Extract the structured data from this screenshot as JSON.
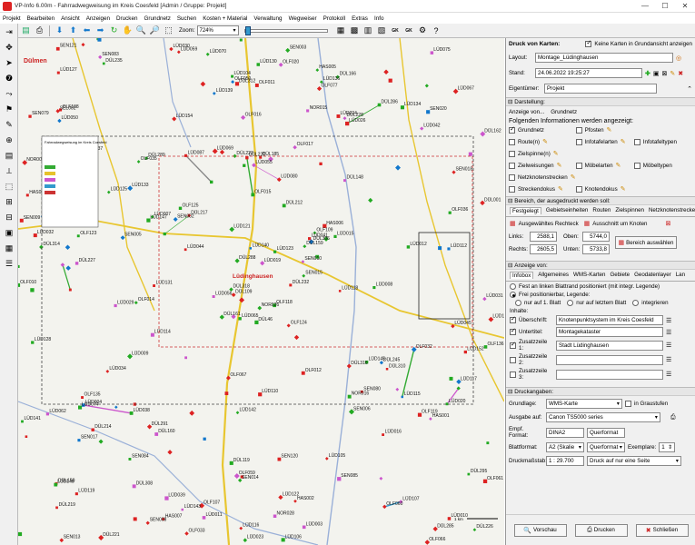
{
  "window": {
    "title": "VP-Info 6.00m - Fahrradwegweisung im Kreis Coesfeld [Admin / Gruppe: Projekt]",
    "minimize": "—",
    "maximize": "☐",
    "close": "✕"
  },
  "menu": [
    "Projekt",
    "Bearbeiten",
    "Ansicht",
    "Anzeigen",
    "Drucken",
    "Grundnetz",
    "Suchen",
    "Kosten + Material",
    "Verwaltung",
    "Wegweiser",
    "Protokoll",
    "Extras",
    "Info"
  ],
  "toolbar": {
    "zoom_label": "Zoom:",
    "zoom_value": "724%",
    "text_buttons": [
      "GK",
      "GK"
    ]
  },
  "map": {
    "town_label": "Dülmen",
    "town_label2": "Lüdinghausen",
    "scale_label": "1 km",
    "legend_title": "Fahrradwegweisung im Kreis Coesfeld",
    "labels": [
      "DÜL46",
      "DÜL147",
      "DÜL109",
      "DÜL150",
      "DÜL159",
      "DÜL160",
      "DÜL166",
      "DÜL185",
      "DÜL228",
      "DÜL232",
      "DÜL235",
      "DÜL226",
      "DÜL227",
      "DÜL162",
      "DÜL161",
      "DÜL148",
      "DÜL221",
      "DÜL223",
      "DÜL212",
      "DÜL214",
      "DÜL217",
      "DÜL219",
      "DÜL308",
      "DÜL220",
      "DÜL306",
      "DÜL310",
      "DÜL337",
      "DÜL312",
      "DÜL314",
      "DÜL316",
      "DÜL001",
      "DÜL318",
      "DÜL119",
      "DÜL288",
      "DÜL289",
      "DÜL286",
      "DÜL291",
      "DÜL285",
      "DÜL295",
      "DÜL245",
      "SEN003",
      "SEN002",
      "SEN005",
      "SEN006",
      "SEN008",
      "SEN009",
      "SEN010",
      "SEN013",
      "SEN014",
      "SEN015",
      "SEN017",
      "SEN018",
      "SEN079",
      "SEN080",
      "SEN085",
      "SEN084",
      "SEN083",
      "SEN121",
      "SEN120",
      "SEN020",
      "LÜD130",
      "LÜD131",
      "LÜD132",
      "LÜD133",
      "LÜD134",
      "LÜD135",
      "LÜD136",
      "LÜD139",
      "LÜD140",
      "LÜD141",
      "LÜD142",
      "LÜD143",
      "LÜD145",
      "LÜD147",
      "LÜD148",
      "LÜD127",
      "LÜD125",
      "LÜD128",
      "LÜD121",
      "LÜD122",
      "LÜD123",
      "LÜD119",
      "LÜD118",
      "LÜD117",
      "LÜD116",
      "LÜD112",
      "LÜD110",
      "LÜD107",
      "LÜD106",
      "LÜD105",
      "LÜD104",
      "LÜD155",
      "LÜD015",
      "LÜD016",
      "LÜD019",
      "LÜD020",
      "LÜD022",
      "LÜD023",
      "LÜD024",
      "LÜD026",
      "LÜD029",
      "LÜD030",
      "LÜD031",
      "LÜD032",
      "LÜD034",
      "LÜD038",
      "LÜD039",
      "LÜD041",
      "LÜD042",
      "LÜD044",
      "LÜD045",
      "LÜD050",
      "LÜD055",
      "LÜD056",
      "LÜD059",
      "LÜD062",
      "LÜD065",
      "LÜD067",
      "LÜD069",
      "LÜD070",
      "LÜD074",
      "LÜD075",
      "LÜD080",
      "LÜD087",
      "LÜD008",
      "LÜD009",
      "LÜD010",
      "LÜD011",
      "LÜD012",
      "LÜD013",
      "LÜD004",
      "LÜD003",
      "LÜD007",
      "LÜD154",
      "LÜD152",
      "LÜD115",
      "LÜD114",
      "OLF135",
      "OLF136",
      "OLF125",
      "OLF124",
      "OLF123",
      "OLF119",
      "OLF118",
      "OLF109",
      "OLF108",
      "OLF107",
      "OLF060",
      "OLF059",
      "OLF050",
      "OLF036",
      "OLF035",
      "OLF034",
      "OLF033",
      "OLF032",
      "OLF020",
      "OLF016",
      "OLF015",
      "OLF014",
      "OLF017",
      "OLF012",
      "OLF011",
      "OLF010",
      "OLF013",
      "OLF077",
      "OLF068",
      "OLF067",
      "OLF061",
      "OLF064",
      "OLF066",
      "HAS001",
      "HAS002",
      "HAS004",
      "HAS005",
      "HAS006",
      "HAS007",
      "NOR015",
      "NOR016",
      "NOR001",
      "NOR018",
      "NOR025",
      "NOR026",
      "NOR028",
      "SEL001",
      "SEL002"
    ]
  },
  "panel": {
    "druck_von_karten": "Druck von Karten:",
    "keine_karten": "Keine Karten in Grundansicht anzeigen",
    "layout_label": "Layout:",
    "layout_value": "Montage_Lüdinghausen",
    "stand_label": "Stand:",
    "stand_value": "24.06.2022 19:25:27",
    "eigentuemer_label": "Eigentümer:",
    "eigentuemer_value": "Projekt",
    "darstellung": "Darstellung:",
    "anzeige_von": "Anzeige von...",
    "anzeige_von_value": "Grundnetz",
    "folgende_info": "Folgenden Informationen werden angezeigt:",
    "info_items": [
      {
        "label": "Grundnetz",
        "checked": true
      },
      {
        "label": "Pfosten",
        "checked": false
      },
      {
        "label": "",
        "checked": false
      },
      {
        "label": "Route(n)",
        "checked": false
      },
      {
        "label": "Infotafelarten",
        "checked": false
      },
      {
        "label": "Infotafeltypen",
        "checked": false
      },
      {
        "label": "Zielspinne(n)",
        "checked": false
      },
      {
        "label": "",
        "checked": false
      },
      {
        "label": "",
        "checked": false
      },
      {
        "label": "Zielweisungen",
        "checked": false
      },
      {
        "label": "Möbelarten",
        "checked": false
      },
      {
        "label": "Möbeltypen",
        "checked": false
      },
      {
        "label": "Netzknotenstrecken",
        "checked": false
      },
      {
        "label": "",
        "checked": false
      },
      {
        "label": "",
        "checked": false
      },
      {
        "label": "Streckendokus",
        "checked": false
      },
      {
        "label": "Knotendokus",
        "checked": false
      },
      {
        "label": "",
        "checked": false
      }
    ],
    "bereich": "Bereich, der ausgedruckt werden soll:",
    "bereich_tabs": [
      "Festgelegt",
      "Gebietseinheiten",
      "Routen",
      "Zielspinnen",
      "Netzknotenstrecken"
    ],
    "ausgewaehltes_rechteck": "Ausgewähltes Rechteck",
    "ausschnitt_um_knoten": "Ausschnitt um Knoten",
    "links_label": "Links:",
    "links_value": "2588,1",
    "oben_label": "Oben:",
    "oben_value": "5744,0",
    "rechts_label": "Rechts:",
    "rechts_value": "2605,5",
    "unten_label": "Unten:",
    "unten_value": "5733,8",
    "bereich_auswaehlen": "Bereich auswählen",
    "anzeige_von2": "Anzeige von:",
    "anzeige_tabs": [
      "Infobox",
      "Allgemeines",
      "WMS-Karten",
      "Gebiete",
      "Geodatenlayer",
      "Lan"
    ],
    "fest_rand": "Fest an linken Blattrand positioniert (mit integr. Legende)",
    "frei_positionierbar": "Frei positionierbar, Legende:",
    "nur_1_blatt": "nur auf 1. Blatt",
    "nur_letztem": "nur auf letztem Blatt",
    "integrieren": "integrieren",
    "inhalte": "Inhalte:",
    "inhalte_rows": [
      {
        "label": "Überschrift:",
        "value": "Knotenpunktsystem im Kreis Coesfeld",
        "checked": true
      },
      {
        "label": "Untertitel:",
        "value": "Montagekataster",
        "checked": true
      },
      {
        "label": "Zusatzzeile 1:",
        "value": "Stadt Lüdinghausen",
        "checked": true
      },
      {
        "label": "Zusatzzeile 2:",
        "value": "",
        "checked": false
      },
      {
        "label": "Zusatzzeile 3:",
        "value": "",
        "checked": false
      }
    ],
    "druckangaben": "Druckangaben:",
    "grundlage_label": "Grundlage:",
    "grundlage_value": "WMS-Karte",
    "in_grau": "in Graustufen",
    "ausgabe_label": "Ausgabe auf:",
    "ausgabe_value": "Canon TS5000 series",
    "empf_format_label": "Empf. Format:",
    "empf_format_value": "DINA2",
    "empf_orient": "Querformat",
    "blattformat_label": "Blattformat:",
    "blattformat_value": "A2 (Skalie",
    "blatt_orient": "Querformat",
    "exemplare_label": "Exemplare:",
    "exemplare_value": "1",
    "massstab_label": "Druckmaßstab:",
    "massstab_value": "1 : 29.700",
    "druck_seite": "Druck auf nur eine Seite",
    "vorschau": "Vorschau",
    "drucken": "Drucken",
    "schliessen": "Schließen"
  }
}
